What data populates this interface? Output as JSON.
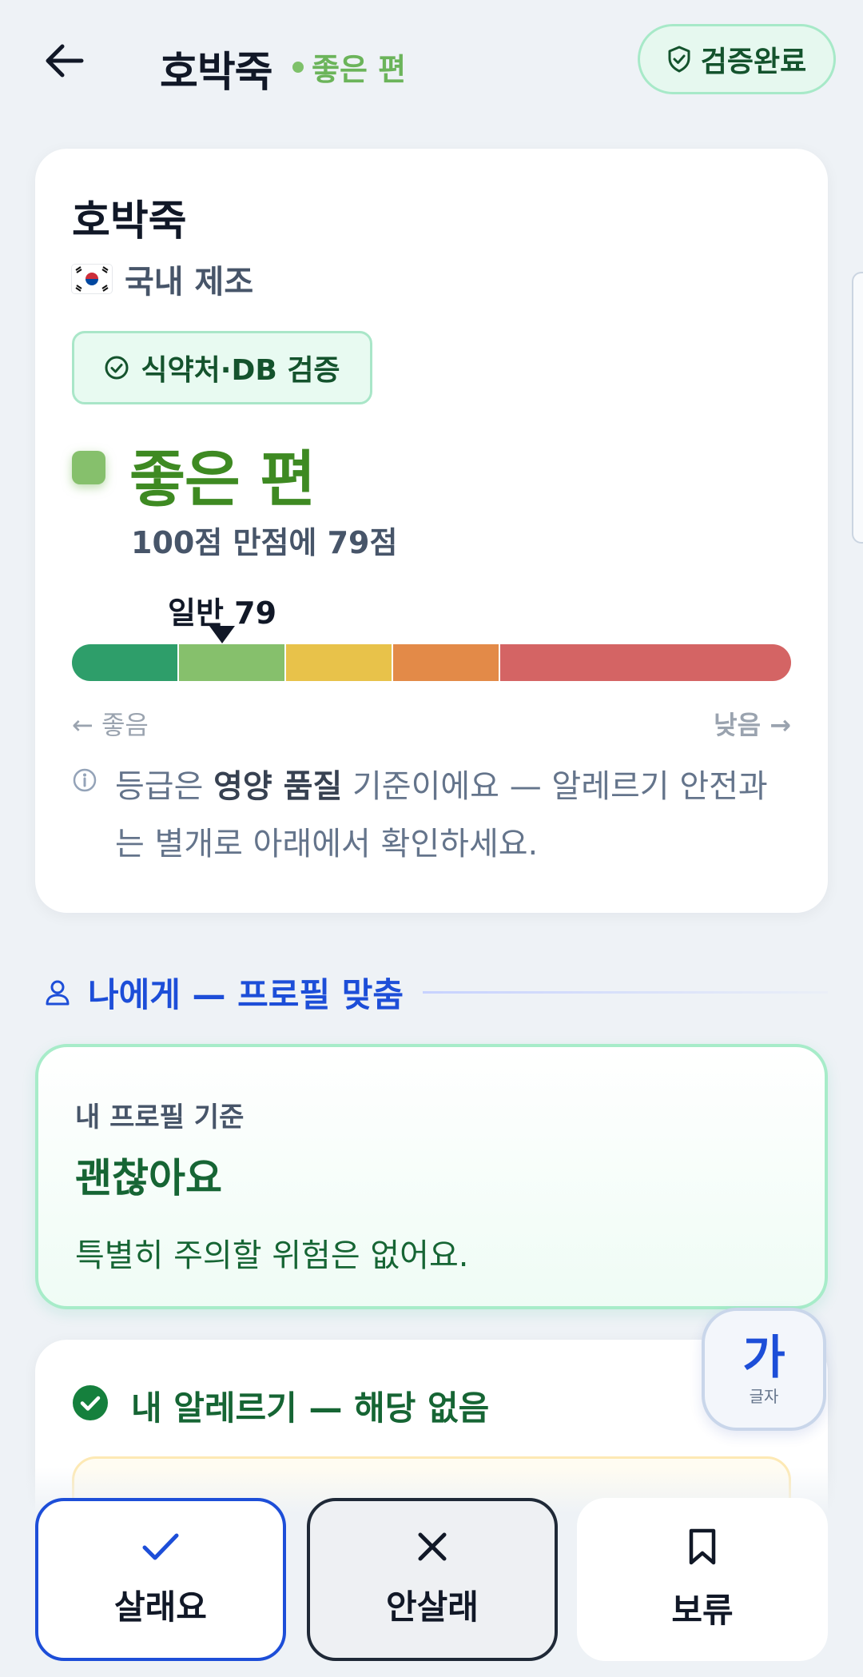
{
  "header": {
    "title": "호박죽",
    "grade": "좋은 편",
    "verified_label": "검증완료"
  },
  "product": {
    "name": "호박죽",
    "origin": "국내 제조",
    "verify_badge": "식약처·DB 검증",
    "grade": "좋은 편",
    "score_text": "100점 만점에 79점",
    "marker_label": "일반 79",
    "scale_left": "← 좋음",
    "scale_right": "낮음 →",
    "info_pre": "등급은 ",
    "info_bold": "영양 품질",
    "info_post": " 기준이에요 — 알레르기 안전과는 별개로 아래에서 확인하세요.",
    "grade_color": "#86c06c",
    "scale_colors": [
      "#2e9e6a",
      "#86c06c",
      "#e8c24a",
      "#e38a48",
      "#d46464"
    ]
  },
  "profile_section": {
    "title": "나에게 — 프로필 맞춤"
  },
  "profile_card": {
    "label": "내 프로필 기준",
    "status": "괜찮아요",
    "description": "특별히 주의할 위험은 없어요."
  },
  "allergy_card": {
    "title": "내 알레르기 — 해당 없음"
  },
  "font_fab": {
    "main": "가",
    "sub": "글자"
  },
  "actions": {
    "buy": "살래요",
    "no_buy": "안살래",
    "hold": "보류"
  },
  "colors": {
    "accent_blue": "#1d4ed8",
    "success_green": "#166534"
  }
}
